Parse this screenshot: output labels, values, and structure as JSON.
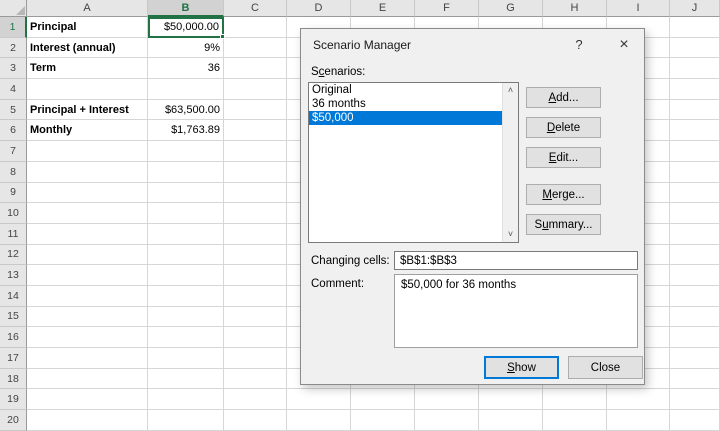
{
  "spreadsheet": {
    "column_headers": [
      "A",
      "B",
      "C",
      "D",
      "E",
      "F",
      "G",
      "H",
      "I",
      "J"
    ],
    "row_headers": [
      "1",
      "2",
      "3",
      "4",
      "5",
      "6",
      "7",
      "8",
      "9",
      "10",
      "11",
      "12",
      "13",
      "14",
      "15",
      "16",
      "17",
      "18",
      "19",
      "20"
    ],
    "selected_column": "B",
    "selected_row": "1",
    "cells": [
      {
        "row": 1,
        "label": "Principal",
        "value": "$50,000.00",
        "selected": true
      },
      {
        "row": 2,
        "label": "Interest (annual)",
        "value": "9%"
      },
      {
        "row": 3,
        "label": "Term",
        "value": "36"
      },
      {
        "row": 5,
        "label": "Principal + Interest",
        "value": "$63,500.00"
      },
      {
        "row": 6,
        "label": "Monthly",
        "value": "$1,763.89"
      }
    ]
  },
  "dialog": {
    "title": "Scenario Manager",
    "icons": {
      "help": "?",
      "close": "×",
      "scroll_up": "˄",
      "scroll_down": "˅"
    },
    "scenarios_label": "Scenarios:",
    "scenarios": [
      {
        "name": "Original",
        "selected": false
      },
      {
        "name": "36 months",
        "selected": false
      },
      {
        "name": "$50,000",
        "selected": true
      }
    ],
    "buttons": {
      "add": "Add...",
      "delete": "Delete",
      "edit": "Edit...",
      "merge": "Merge...",
      "summary": "Summary..."
    },
    "changing_cells_label": "Changing cells:",
    "changing_cells_value": "$B$1:$B$3",
    "comment_label": "Comment:",
    "comment_value": "$50,000 for 36 months",
    "show_button": "Show",
    "close_button": "Close"
  },
  "colors": {
    "accent_blue": "#0078d7",
    "excel_green": "#217346",
    "list_selection_bg": "#0078d7",
    "dialog_bg": "#f0f0f0",
    "button_bg": "#e1e1e1"
  }
}
